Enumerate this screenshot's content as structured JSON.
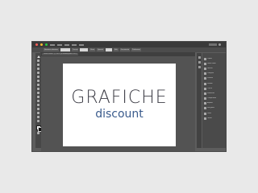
{
  "menubar": {
    "window_buttons": [
      "#ff5f57",
      "#febc2e",
      "#28c840"
    ],
    "items_count_label": "",
    "search_placeholder": ""
  },
  "control_bar": {
    "items": [
      "Nessuna selezione",
      "",
      "Traccia",
      "",
      "Base",
      "Opacità",
      "",
      "Stile",
      "Documento",
      "Preferenze"
    ]
  },
  "document_tab": {
    "label": "Senza titolo-1 @ 100% (RGB/Anteprima GPU)"
  },
  "artboard": {
    "logo_top": "GRAFICHE",
    "logo_bottom": "discount"
  },
  "panels": {
    "items": [
      {
        "label": "Colore",
        "icon": "color-icon"
      },
      {
        "label": "Guida colori",
        "icon": "color-guide-icon"
      },
      {
        "label": "Libreria",
        "icon": "library-icon"
      },
      {
        "label": "Campioni",
        "icon": "swatches-icon"
      },
      {
        "label": "Pennelli",
        "icon": "brushes-icon"
      },
      {
        "label": "Simboli",
        "icon": "symbols-icon"
      },
      {
        "label": "Traccia",
        "icon": "stroke-icon"
      },
      {
        "label": "Sfumatura",
        "icon": "gradient-icon"
      },
      {
        "label": "Trasparenza",
        "icon": "transparency-icon"
      },
      {
        "label": "Aspetto",
        "icon": "appearance-icon"
      },
      {
        "label": "Stili grafici",
        "icon": "graphic-styles-icon"
      },
      {
        "label": "Livelli",
        "icon": "layers-icon"
      },
      {
        "label": "Tavole",
        "icon": "artboards-icon"
      }
    ]
  },
  "colors": {
    "logo_dark": "#3d3d46",
    "logo_blue": "#3a5b8c",
    "ui_dark": "#535353"
  }
}
